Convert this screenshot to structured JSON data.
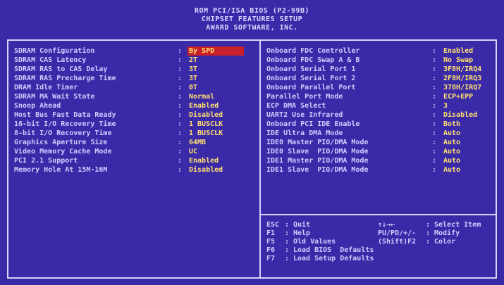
{
  "header": {
    "line1": "ROM PCI/ISA BIOS (P2-99B)",
    "line2": "CHIPSET FEATURES SETUP",
    "line3": "AWARD SOFTWARE, INC."
  },
  "left_items": [
    {
      "label": "SDRAM Configuration",
      "value": "By SPD"
    },
    {
      "label": "SDRAM CAS Latency",
      "value": "2T"
    },
    {
      "label": "SDRAM RAS to CAS Delay",
      "value": "3T"
    },
    {
      "label": "SDRAM RAS Precharge Time",
      "value": "3T"
    },
    {
      "label": "DRAM Idle Timer",
      "value": "0T"
    },
    {
      "label": "SDRAM MA Wait State",
      "value": "Normal"
    },
    {
      "label": "Snoop Ahead",
      "value": "Enabled"
    },
    {
      "label": "Host Bus Fast Data Ready",
      "value": "Disabled"
    },
    {
      "label": "16-bit I/O Recovery Time",
      "value": "1 BUSCLK"
    },
    {
      "label": "8-bit I/O Recovery Time",
      "value": "1 BUSCLK"
    },
    {
      "label": "Graphics Aperture Size",
      "value": "64MB"
    },
    {
      "label": "Video Memory Cache Mode",
      "value": "UC"
    },
    {
      "label": "PCI 2.1 Support",
      "value": "Enabled"
    },
    {
      "label": "Memory Hole At 15M-16M",
      "value": "Disabled"
    }
  ],
  "right_items": [
    {
      "label": "Onboard FDC Controller",
      "value": "Enabled"
    },
    {
      "label": "Onboard FDC Swap A & B",
      "value": "No Swap"
    },
    {
      "label": "Onboard Serial Port 1",
      "value": "3F8H/IRQ4"
    },
    {
      "label": "Onboard Serial Port 2",
      "value": "2F8H/IRQ3"
    },
    {
      "label": "Onboard Parallel Port",
      "value": "378H/IRQ7"
    },
    {
      "label": "Parallel Port Mode",
      "value": "ECP+EPP"
    },
    {
      "label": "ECP DMA Select",
      "value": "3"
    },
    {
      "label": "UART2 Use Infrared",
      "value": "Disabled"
    },
    {
      "label": "Onboard PCI IDE Enable",
      "value": "Both"
    },
    {
      "label": "IDE Ultra DMA Mode",
      "value": "Auto"
    },
    {
      "label": "IDE0 Master PIO/DMA Mode",
      "value": "Auto"
    },
    {
      "label": "IDE0 Slave  PIO/DMA Mode",
      "value": "Auto"
    },
    {
      "label": "IDE1 Master PIO/DMA Mode",
      "value": "Auto"
    },
    {
      "label": "IDE1 Slave  PIO/DMA Mode",
      "value": "Auto"
    }
  ],
  "separator": ":",
  "help": [
    {
      "key": "ESC",
      "desc": "Quit",
      "key2": "↑↓→←",
      "desc2": "Select Item"
    },
    {
      "key": "F1",
      "desc": "Help",
      "key2": "PU/PD/+/-",
      "desc2": "Modify"
    },
    {
      "key": "F5",
      "desc": "Old Values",
      "key2": "(Shift)F2",
      "desc2": "Color"
    },
    {
      "key": "F6",
      "desc": "Load BIOS  Defaults",
      "key2": "",
      "desc2": ""
    },
    {
      "key": "F7",
      "desc": "Load Setup Defaults",
      "key2": "",
      "desc2": ""
    }
  ],
  "colors": {
    "background": "#3a2aa8",
    "value": "#ffe070",
    "highlight": "#c8202a"
  }
}
